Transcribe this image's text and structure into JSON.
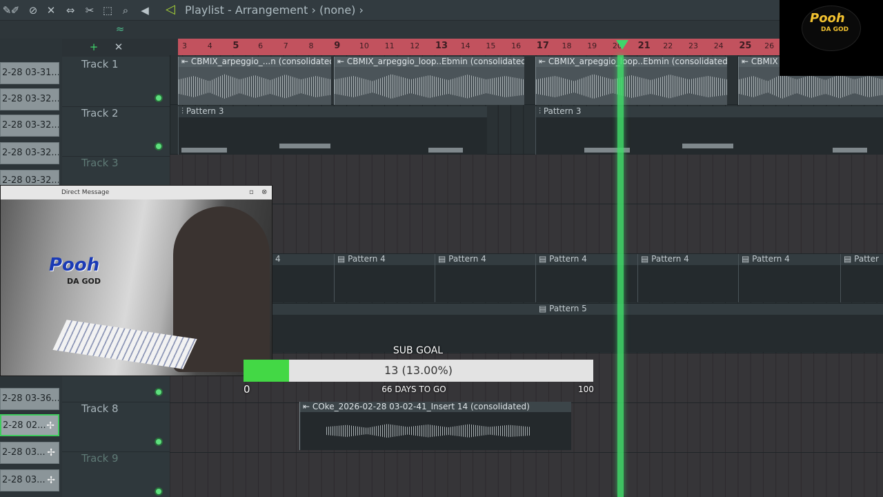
{
  "toolbar": {
    "title": "Playlist - Arrangement",
    "pattern_selector": "(none)"
  },
  "ruler": {
    "bars": [
      "3",
      "4",
      "5",
      "6",
      "7",
      "8",
      "9",
      "10",
      "11",
      "12",
      "13",
      "14",
      "15",
      "16",
      "17",
      "18",
      "19",
      "20",
      "21",
      "22",
      "23",
      "24",
      "25",
      "26"
    ],
    "major_bars": [
      "5",
      "9",
      "13",
      "17",
      "21",
      "25"
    ]
  },
  "left_clips": [
    "2-28 03-31...",
    "2-28 03-32...",
    "2-28 03-32...",
    "2-28 03-32...",
    "2-28 03-32...",
    "2-28 03-36...",
    "2-28 02...",
    "2-28 03...",
    "2-28 03..."
  ],
  "tracks": [
    {
      "name": "Track 1",
      "dim": false
    },
    {
      "name": "Track 2",
      "dim": false
    },
    {
      "name": "Track 3",
      "dim": true
    },
    {
      "name": "Track 8",
      "dim": false
    },
    {
      "name": "Track 9",
      "dim": true
    }
  ],
  "audio_clips": {
    "track1": [
      "CBMIX_arpeggio_...n (consolidated)",
      "CBMIX_arpeggio_loop..Ebmin (consolidated)",
      "CBMIX_arpeggio_loop..Ebmin (consolidated)",
      "CBMIX"
    ],
    "track8": "COke_2026-02-28 03-02-41_Insert 14 (consolidated)"
  },
  "pattern_clips": {
    "track2": [
      "Pattern 3",
      "Pattern 3"
    ],
    "track6": [
      "4",
      "Pattern 4",
      "Pattern 4",
      "Pattern 4",
      "Pattern 4",
      "Pattern 4",
      "Patter"
    ],
    "track7": [
      "Pattern 5"
    ]
  },
  "webcam": {
    "window_title": "Direct Message",
    "logo_text": "Pooh",
    "logo_sub": "DA GOD"
  },
  "sub_goal": {
    "title": "SUB GOAL",
    "value_text": "13 (13.00%)",
    "progress_percent": 13,
    "min": "0",
    "max": "100",
    "days_text": "66 DAYS TO GO"
  },
  "brand": {
    "logo_text": "Pooh",
    "logo_sub": "DA GOD"
  },
  "colors": {
    "ruler": "#c2525e",
    "playhead": "#3fda68",
    "goal_fill": "#43d845"
  }
}
